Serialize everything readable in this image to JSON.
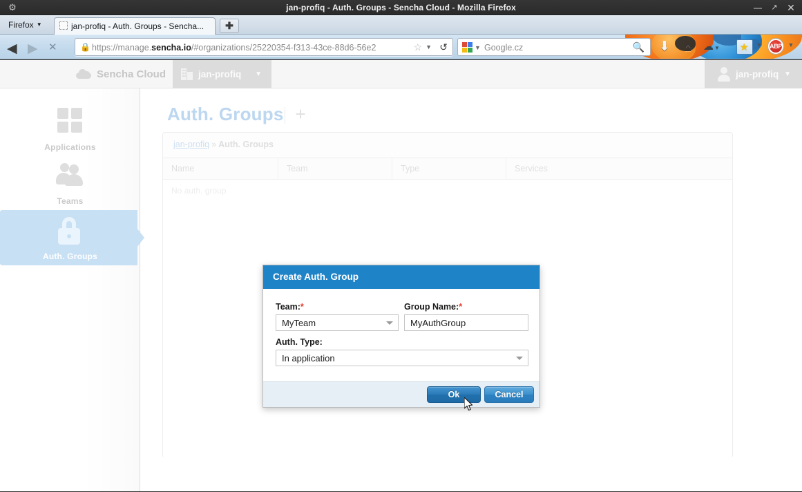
{
  "window": {
    "title": "jan-profiq - Auth. Groups - Sencha Cloud - Mozilla Firefox",
    "gear_icon": "gear-icon",
    "minimize_label": "—",
    "maximize_label": "↗",
    "close_label": "✕"
  },
  "browser": {
    "app_menu_label": "Firefox",
    "app_menu_caret": "▼",
    "tab": {
      "title": "jan-profiq - Auth. Groups - Sencha...",
      "favicon": "blank-favicon-icon"
    },
    "new_tab_label": "✚",
    "nav": {
      "back_icon": "◀",
      "forward_icon": "▶",
      "stop_icon": "✕"
    },
    "url": {
      "lock_icon": "🔒",
      "scheme": "https://manage.",
      "domain": "sencha.io",
      "path": "/#organizations/25220354-f313-43ce-88d6-56e2",
      "star_icon": "☆",
      "dropdown_icon": "▼",
      "reload_icon": "↺"
    },
    "search": {
      "engine": "google-logo-icon",
      "dropdown_icon": "▼",
      "placeholder": "Google.cz",
      "go_icon": "🔍"
    },
    "toolbar_icons": {
      "download": "⬇",
      "home": "⌂",
      "sync": "☁",
      "sync_caret": "▼",
      "bookmark_star": "★",
      "bookmark_caret": "▼",
      "adblock_label": "ABP",
      "adblock_caret": "▼"
    }
  },
  "app": {
    "brand": "Sencha Cloud",
    "organization": "jan-profiq",
    "organization_caret": "▼",
    "user": "jan-profiq",
    "user_caret": "▼"
  },
  "sidebar": {
    "items": [
      {
        "label": "Applications",
        "icon": "grid-icon",
        "selected": false
      },
      {
        "label": "Teams",
        "icon": "people-icon",
        "selected": false
      },
      {
        "label": "Auth. Groups",
        "icon": "lock-icon",
        "selected": true
      }
    ]
  },
  "content": {
    "page_title": "Auth. Groups",
    "add_button_label": "+",
    "breadcrumb": {
      "root": "jan-profiq",
      "separator": "»",
      "current": "Auth. Groups"
    },
    "grid": {
      "columns": [
        "Name",
        "Team",
        "Type",
        "Services"
      ],
      "empty_text": "No auth. group",
      "rows": []
    }
  },
  "dialog": {
    "title": "Create Auth. Group",
    "fields": {
      "team": {
        "label": "Team:",
        "required_marker": "*",
        "value": "MyTeam",
        "options": [
          "MyTeam"
        ]
      },
      "group_name": {
        "label": "Group Name:",
        "required_marker": "*",
        "value": "MyAuthGroup",
        "placeholder": ""
      },
      "auth_type": {
        "label": "Auth. Type:",
        "required_marker": "",
        "value": "In application",
        "options": [
          "In application"
        ]
      }
    },
    "buttons": {
      "ok": "Ok",
      "cancel": "Cancel"
    }
  },
  "colors": {
    "dialog_header": "#1f83c8",
    "primary_button": "#2a7ab8",
    "sidebar_selected": "#c8e0f4",
    "required_marker": "#e43b2c"
  }
}
